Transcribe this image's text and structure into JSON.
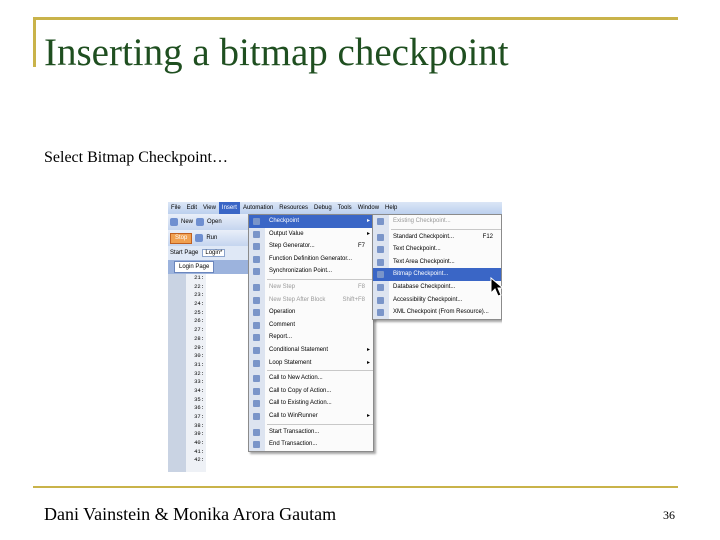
{
  "slide": {
    "title": "Inserting a bitmap checkpoint",
    "subtitle": "Select Bitmap Checkpoint…",
    "author": "Dani Vainstein & Monika Arora Gautam",
    "page_number": "36",
    "frame_color": "#c9b34a",
    "title_color": "#1f4f20"
  },
  "app": {
    "menubar": [
      "File",
      "Edit",
      "View",
      "Insert",
      "Automation",
      "Resources",
      "Debug",
      "Tools",
      "Window",
      "Help"
    ],
    "active_menu": "Insert",
    "toolbar": {
      "new_label": "New",
      "open_label": "Open",
      "stop_label": "Stop",
      "run_label": "Run"
    },
    "tabs": [
      "Start Page",
      "Login*"
    ],
    "action_tab": "Login Page",
    "line_numbers": [
      "21:",
      "22:",
      "23:",
      "24:",
      "25:",
      "26:",
      "27:",
      "28:",
      "29:",
      "30:",
      "31:",
      "32:",
      "33:",
      "34:",
      "35:",
      "36:",
      "37:",
      "38:",
      "39:",
      "40:",
      "41:",
      "42:"
    ],
    "insert_menu": [
      {
        "label": "Checkpoint",
        "submenu": true,
        "highlight": true
      },
      {
        "label": "Output Value",
        "submenu": true
      },
      {
        "label": "Step Generator...",
        "shortcut": "F7"
      },
      {
        "label": "Function Definition Generator..."
      },
      {
        "label": "Synchronization Point..."
      },
      {
        "sep": true
      },
      {
        "label": "New Step",
        "shortcut": "F8",
        "disabled": true
      },
      {
        "label": "New Step After Block",
        "shortcut": "Shift+F8",
        "disabled": true
      },
      {
        "label": "Operation"
      },
      {
        "label": "Comment"
      },
      {
        "label": "Report..."
      },
      {
        "label": "Conditional Statement",
        "submenu": true
      },
      {
        "label": "Loop Statement",
        "submenu": true
      },
      {
        "sep": true
      },
      {
        "label": "Call to New Action..."
      },
      {
        "label": "Call to Copy of Action..."
      },
      {
        "label": "Call to Existing Action..."
      },
      {
        "label": "Call to WinRunner",
        "submenu": true
      },
      {
        "sep": true
      },
      {
        "label": "Start Transaction..."
      },
      {
        "label": "End Transaction..."
      }
    ],
    "checkpoint_menu": [
      {
        "label": "Existing Checkpoint...",
        "disabled": true
      },
      {
        "sep": true
      },
      {
        "label": "Standard Checkpoint...",
        "shortcut": "F12"
      },
      {
        "label": "Text Checkpoint..."
      },
      {
        "label": "Text Area Checkpoint..."
      },
      {
        "label": "Bitmap Checkpoint...",
        "highlight": true
      },
      {
        "label": "Database Checkpoint..."
      },
      {
        "label": "Accessibility Checkpoint..."
      },
      {
        "label": "XML Checkpoint (From Resource)..."
      }
    ]
  }
}
